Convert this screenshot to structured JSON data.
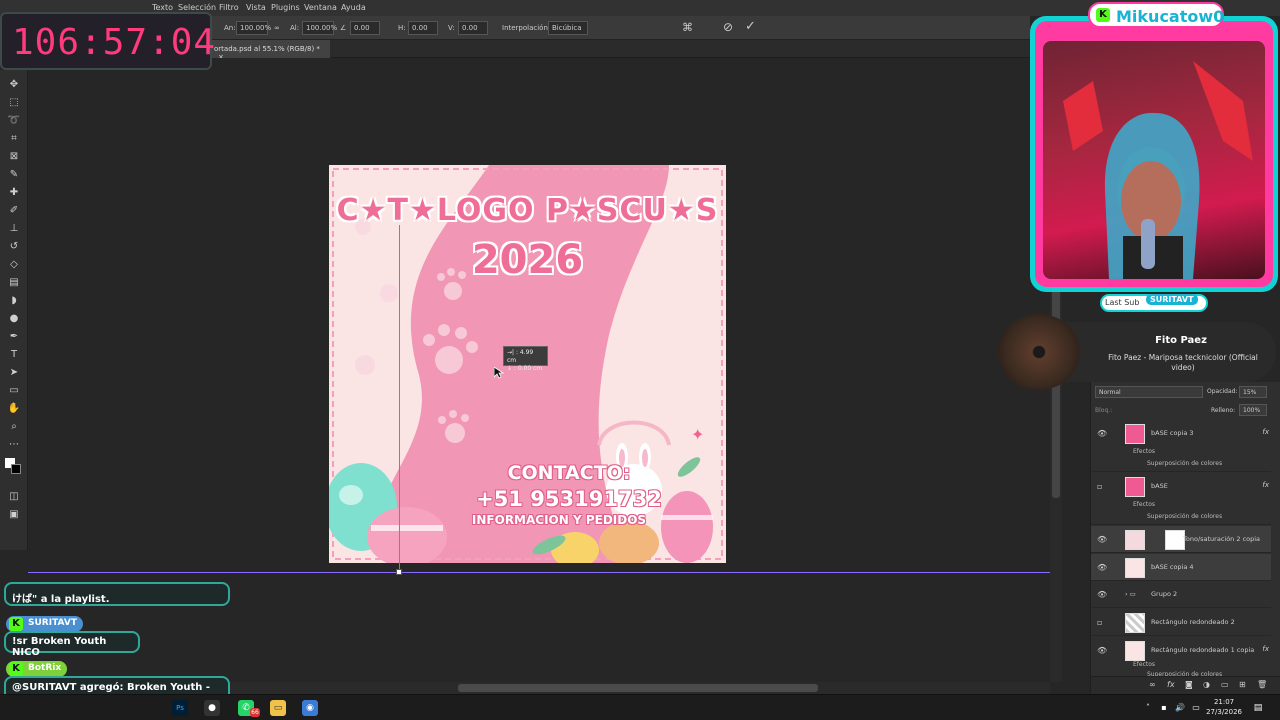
{
  "menubar": {
    "items": [
      "Texto",
      "Selección",
      "Filtro",
      "Vista",
      "Plugins",
      "Ventana",
      "Ayuda"
    ]
  },
  "options": {
    "an_label": "An:",
    "an_value": "100.00%",
    "al_label": "Al:",
    "al_value": "100.00%",
    "angle_label": "Ángulo",
    "angle_value": "0.00",
    "h_label": "H:",
    "h_value": "0.00",
    "v_label": "V:",
    "v_value": "0.00",
    "interp_label": "Interpolación:",
    "interp_value": "Bicúbica"
  },
  "document": {
    "tab_label": "ortada.psd al 55.1% (RGB/8) *",
    "title_line1": "C★T★LOGO P★SCU★S",
    "title_line2": "2026",
    "contact_line1": "CONTACTO:",
    "contact_line2": "+51 953191732",
    "contact_line3": "INFORMACION Y PEDIDOS"
  },
  "measure": {
    "line1": "→| : 4.99 cm",
    "line2": "↓ : 0.00 cm"
  },
  "layers": {
    "blend_mode": "Normal",
    "opacity_label": "Opacidad:",
    "opacity_value": "15%",
    "lock_label": "Bloq.:",
    "fill_label": "Relleno:",
    "fill_value": "100%",
    "effects_label": "Efectos",
    "overlay_label": "Superposición de colores",
    "rows": [
      {
        "name": "bASE copia 3",
        "fx": "fx"
      },
      {
        "name": "bASE",
        "fx": "fx"
      },
      {
        "name": "Tono/saturación 2 copia",
        "fx": ""
      },
      {
        "name": "bASE copia 4",
        "fx": ""
      },
      {
        "name": "Grupo 2",
        "fx": ""
      },
      {
        "name": "Rectángulo redondeado 2",
        "fx": ""
      },
      {
        "name": "Rectángulo redondeado 1 copia",
        "fx": "fx"
      }
    ]
  },
  "stream": {
    "timer": "106:57:04",
    "streamer_name": "Mikucatow0",
    "lastsub_label": "Last Sub",
    "lastsub_name": "SURITAVT",
    "music_title": "Fito Paez",
    "music_subtitle": "Fito Paez - Mariposa tecknicolor (Official video)"
  },
  "chat": {
    "msg1": "けば\" a la playlist.",
    "user2": "SURITAVT",
    "msg2": "!sr Broken Youth NICO",
    "user3": "BotRix",
    "msg3": "@SURITAVT agregó: Broken Youth - Original Version a la playlist."
  },
  "taskbar": {
    "time": "21:07",
    "date": "27/3/2026",
    "whatsapp_badge": "66"
  },
  "colors": {
    "accent_pink": "#ff3aa1",
    "accent_cyan": "#11d3d3",
    "timer_red": "#ff3b7d",
    "kick_green": "#53fc18",
    "guide_purple": "#8a6bff"
  }
}
